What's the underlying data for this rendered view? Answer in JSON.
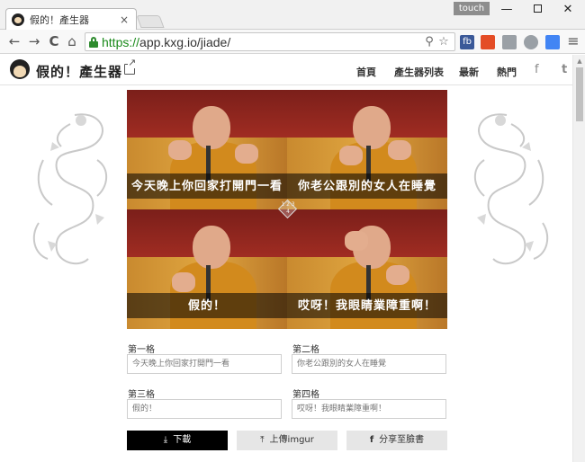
{
  "browser": {
    "tab_title": "假的！產生器",
    "tab_close": "×",
    "touch_label": "touch",
    "url_scheme": "https://",
    "url_rest": "app.kxg.io/jiade/",
    "window_min": "—",
    "window_close": "✕",
    "nav_back": "←",
    "nav_forward": "→",
    "nav_reload": "C",
    "nav_home": "⌂",
    "zoom_icon": "⚲",
    "star_icon": "☆",
    "menu_icon": "≡",
    "extensions": [
      {
        "label": "fb",
        "color": "#3b5998"
      },
      {
        "label": "",
        "color": "#e44d26"
      },
      {
        "label": "",
        "color": "#9aa0a6"
      },
      {
        "label": "",
        "color": "#9aa0a6"
      },
      {
        "label": "",
        "color": "#4285f4"
      }
    ]
  },
  "header": {
    "site_title": "假的！產生器",
    "nav": [
      "首頁",
      "產生器列表",
      "最新",
      "熱門"
    ],
    "facebook_icon": "f",
    "twitter_icon": "t"
  },
  "meme": {
    "captions": [
      "今天晚上你回家打開門一看",
      "你老公跟別的女人在睡覺",
      "假的！",
      "哎呀！我眼睛業障重啊！"
    ],
    "grid_badge": "1 2 3 4"
  },
  "form": {
    "fields": [
      {
        "label": "第一格",
        "placeholder": "今天晚上你回家打開門一看"
      },
      {
        "label": "第二格",
        "placeholder": "你老公跟別的女人在睡覺"
      },
      {
        "label": "第三格",
        "placeholder": "假的！"
      },
      {
        "label": "第四格",
        "placeholder": "哎呀！我眼睛業障重啊！"
      }
    ],
    "download_label": "下載",
    "imgur_label": "上傳imgur",
    "facebook_label": "分享至臉書",
    "download_icon": "⤓",
    "upload_icon": "⤒",
    "fb_icon": "f"
  },
  "colors": {
    "url_green": "#1a8a1a",
    "download_bg": "#000000",
    "secondary_btn_bg": "#e6e6e6"
  }
}
